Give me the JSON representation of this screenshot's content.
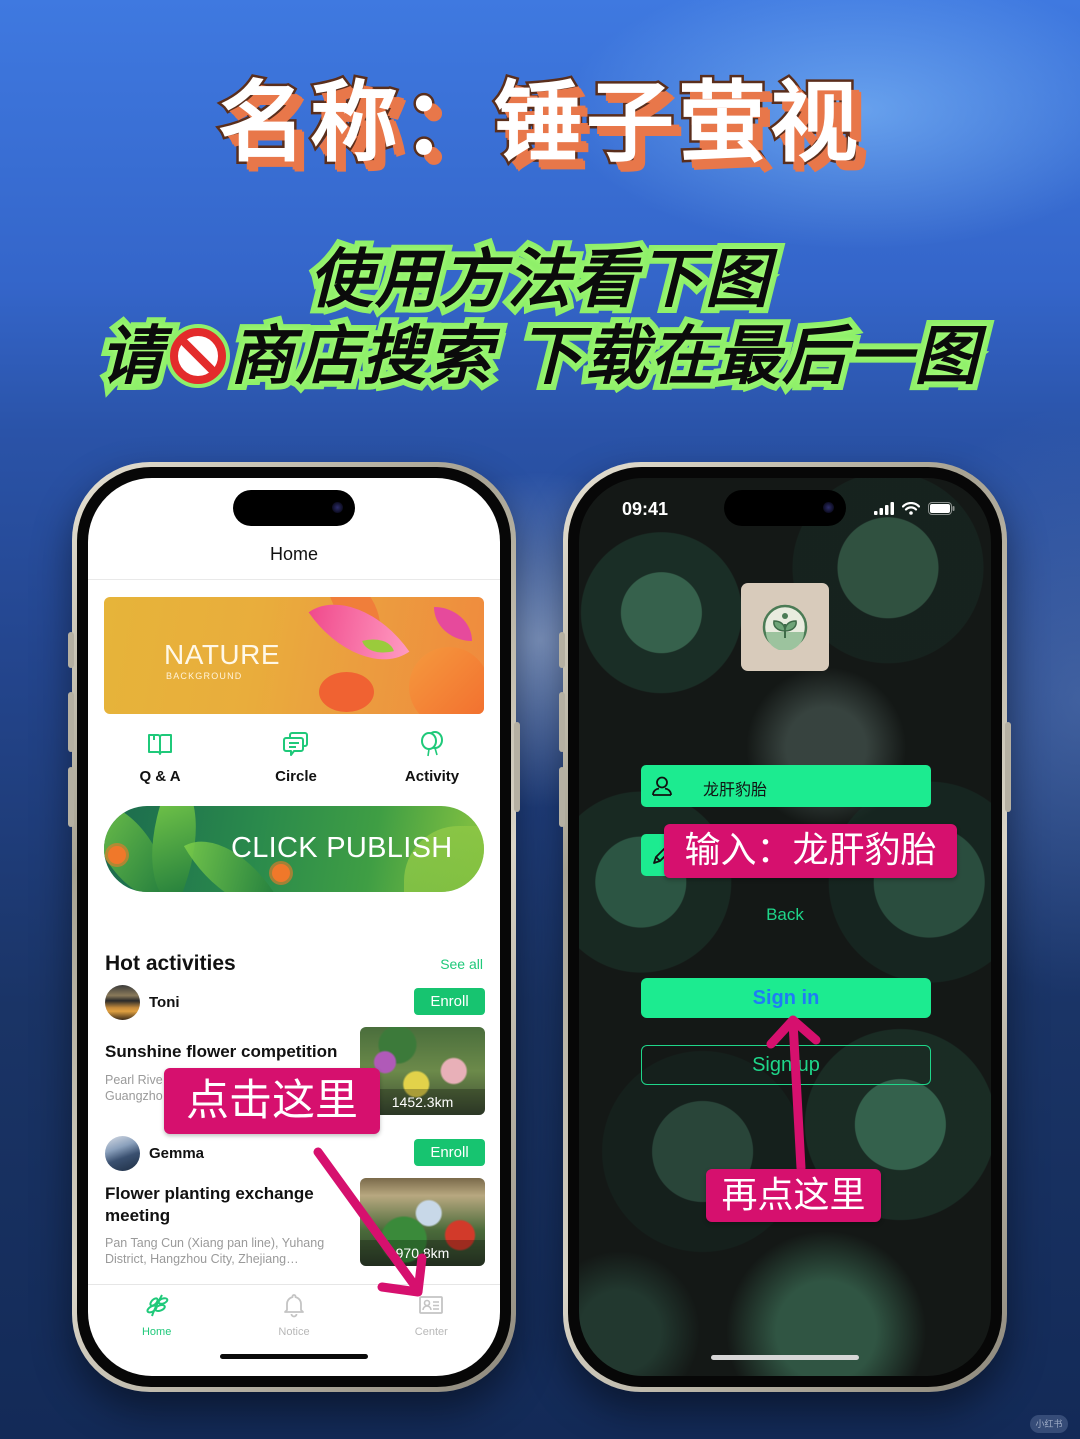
{
  "poster": {
    "title": "名称：锤子萤视",
    "instructions_line1": "使用方法看下图",
    "instructions_line2_prefix": "请",
    "instructions_line2_no_icon": "prohibited-icon",
    "instructions_line2_suffix": "商店搜索 下载在最后一图",
    "watermark": "小红书"
  },
  "annotations": {
    "click_here": "点击这里",
    "input_hint": "输入：龙肝豹胎",
    "click_again": "再点这里",
    "color": "#d6106e"
  },
  "left_phone": {
    "nav_title": "Home",
    "banner": {
      "title": "NATURE",
      "subtitle": "BACKGROUND"
    },
    "quick_actions": [
      {
        "label": "Q & A",
        "icon": "book-icon"
      },
      {
        "label": "Circle",
        "icon": "chat-icon"
      },
      {
        "label": "Activity",
        "icon": "balloon-icon"
      }
    ],
    "publish_label": "CLICK PUBLISH",
    "hot_section": {
      "title": "Hot activities",
      "see_all": "See all"
    },
    "activities": [
      {
        "user": "Toni",
        "enroll_label": "Enroll",
        "title": "Sunshine flower competition",
        "address": "Pearl River ... Guangzhou ...",
        "address_line1": "Pearl Rive",
        "address_line2": "Guangzho",
        "distance": "1452.3km"
      },
      {
        "user": "Gemma",
        "enroll_label": "Enroll",
        "title": "Flower planting exchange meeting",
        "address": "Pan Tang Cun (Xiang pan line), Yuhang District, Hangzhou City, Zhejiang…",
        "distance": "970.8km"
      }
    ],
    "tabs": [
      {
        "label": "Home",
        "icon": "leaf-icon",
        "active": true
      },
      {
        "label": "Notice",
        "icon": "bell-icon",
        "active": false
      },
      {
        "label": "Center",
        "icon": "id-card-icon",
        "active": false
      }
    ],
    "accent_color": "#1fc97a"
  },
  "right_phone": {
    "status_time": "09:41",
    "username_value": "龙肝豹胎",
    "password_value": "",
    "back_label": "Back",
    "signin_label": "Sign in",
    "signup_label": "Sign up",
    "accent_color": "#1ceb90"
  }
}
